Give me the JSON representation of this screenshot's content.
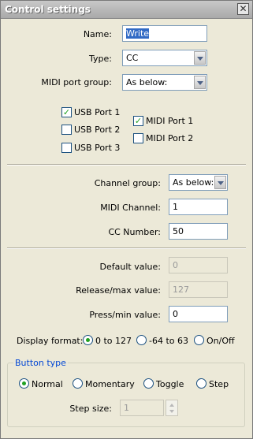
{
  "window": {
    "title": "Control settings",
    "close_glyph": "✕"
  },
  "name_field": {
    "label": "Name:",
    "value": "Write"
  },
  "type_field": {
    "label": "Type:",
    "value": "CC"
  },
  "port_group": {
    "label": "MIDI port group:",
    "value": "As below:"
  },
  "usb_ports": [
    {
      "label": "USB Port 1",
      "checked": true
    },
    {
      "label": "USB Port 2",
      "checked": false
    },
    {
      "label": "USB Port 3",
      "checked": false
    }
  ],
  "midi_ports": [
    {
      "label": "MIDI Port 1",
      "checked": true
    },
    {
      "label": "MIDI Port 2",
      "checked": false
    }
  ],
  "channel_group": {
    "label": "Channel group:",
    "value": "As below:"
  },
  "midi_channel": {
    "label": "MIDI Channel:",
    "value": "1"
  },
  "cc_number": {
    "label": "CC Number:",
    "value": "50"
  },
  "default_value": {
    "label": "Default value:",
    "value": "0"
  },
  "release_value": {
    "label": "Release/max value:",
    "value": "127"
  },
  "press_value": {
    "label": "Press/min value:",
    "value": "0"
  },
  "display_format": {
    "label": "Display format:",
    "options": [
      {
        "label": "0 to 127",
        "selected": true
      },
      {
        "label": "-64 to 63",
        "selected": false
      },
      {
        "label": "On/Off",
        "selected": false
      }
    ]
  },
  "button_type": {
    "legend": "Button type",
    "options": [
      {
        "label": "Normal",
        "selected": true
      },
      {
        "label": "Momentary",
        "selected": false
      },
      {
        "label": "Toggle",
        "selected": false
      },
      {
        "label": "Step",
        "selected": false
      }
    ],
    "step_size": {
      "label": "Step size:",
      "value": "1"
    }
  },
  "colors": {
    "accent_check": "#21a121",
    "group_legend": "#0046d5",
    "selection": "#316ac5"
  }
}
